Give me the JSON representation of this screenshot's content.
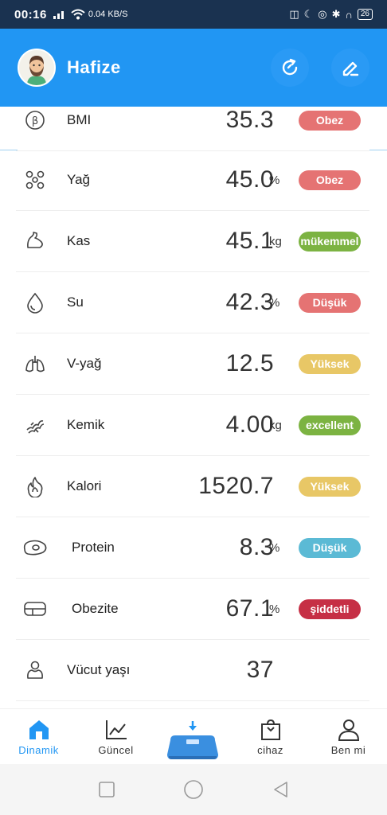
{
  "status_bar": {
    "time": "00:16",
    "net_speed": "0.04 KB/S",
    "battery": "26"
  },
  "header": {
    "username": "Hafize",
    "actions": [
      {
        "icon": "refresh-icon"
      },
      {
        "icon": "edit-icon"
      }
    ]
  },
  "metrics": [
    {
      "label": "BMI",
      "value": "35.3",
      "unit": "",
      "status": "Obez",
      "status_color": "#e57373",
      "icon": "bmi-icon"
    },
    {
      "label": "Yağ",
      "value": "45.0",
      "unit": "%",
      "status": "Obez",
      "status_color": "#e57373",
      "icon": "fat-icon"
    },
    {
      "label": "Kas",
      "value": "45.1",
      "unit": "kg",
      "status": "mükemmel",
      "status_color": "#7cb342",
      "icon": "muscle-icon"
    },
    {
      "label": "Su",
      "value": "42.3",
      "unit": "%",
      "status": "Düşük",
      "status_color": "#e57373",
      "icon": "water-icon"
    },
    {
      "label": "V-yağ",
      "value": "12.5",
      "unit": "",
      "status": "Yüksek",
      "status_color": "#e8c766",
      "icon": "lungs-icon"
    },
    {
      "label": "Kemik",
      "value": "4.00",
      "unit": "kg",
      "status": "excellent",
      "status_color": "#7cb342",
      "icon": "bone-icon"
    },
    {
      "label": "Kalori",
      "value": "1520.7",
      "unit": "",
      "status": "Yüksek",
      "status_color": "#e8c766",
      "icon": "flame-icon"
    },
    {
      "label": "Protein",
      "value": "8.3",
      "unit": "%",
      "status": "Düşük",
      "status_color": "#5bbad5",
      "icon": "protein-icon"
    },
    {
      "label": "Obezite",
      "value": "67.1",
      "unit": "%",
      "status": "şiddetli",
      "status_color": "#c62f45",
      "icon": "obesity-icon"
    },
    {
      "label": "Vücut yaşı",
      "value": "37",
      "unit": "",
      "status": "",
      "status_color": "",
      "icon": "body-age-icon"
    }
  ],
  "tabbar": {
    "tabs": [
      {
        "label": "Dinamik",
        "icon": "home-icon",
        "active": true
      },
      {
        "label": "Güncel",
        "icon": "chart-icon",
        "active": false
      },
      {
        "label": "",
        "icon": "scale-icon",
        "active": false
      },
      {
        "label": "cihaz",
        "icon": "bag-icon",
        "active": false
      },
      {
        "label": "Ben mi",
        "icon": "user-icon",
        "active": false
      }
    ]
  },
  "colors": {
    "primary": "#2196f3",
    "status_bar": "#1a3250"
  }
}
